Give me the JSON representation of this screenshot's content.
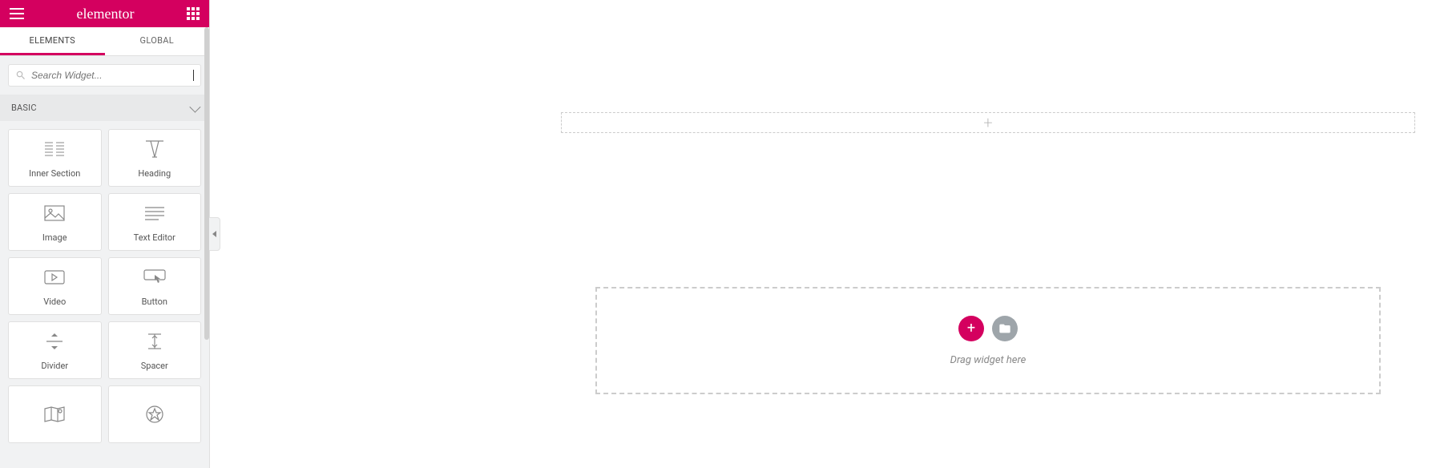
{
  "topbar": {
    "logo": "elementor"
  },
  "tabs": {
    "elements": "ELEMENTS",
    "global": "GLOBAL"
  },
  "search": {
    "placeholder": "Search Widget..."
  },
  "category": {
    "basic": "BASIC"
  },
  "widgets": {
    "inner_section": "Inner Section",
    "heading": "Heading",
    "image": "Image",
    "text_editor": "Text Editor",
    "video": "Video",
    "button": "Button",
    "divider": "Divider",
    "spacer": "Spacer"
  },
  "section": {
    "plus": "+"
  },
  "dropzone": {
    "text": "Drag widget here",
    "plus": "+"
  }
}
